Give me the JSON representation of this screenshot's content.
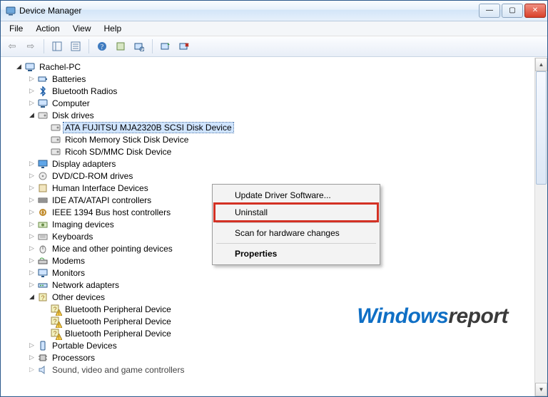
{
  "window": {
    "title": "Device Manager"
  },
  "menubar": [
    "File",
    "Action",
    "View",
    "Help"
  ],
  "toolbar_icons": [
    "nav-back-icon",
    "nav-forward-icon",
    "sep",
    "show-tree-icon",
    "properties-icon",
    "sep",
    "help-icon",
    "action-icon",
    "scan-icon",
    "sep",
    "update-drv-icon",
    "uninstall-drv-icon"
  ],
  "tree": {
    "root": {
      "label": "Rachel-PC",
      "expanded": true,
      "icon": "computer-icon",
      "children": [
        {
          "label": "Batteries",
          "icon": "battery-icon",
          "expanded": false,
          "has_children": true
        },
        {
          "label": "Bluetooth Radios",
          "icon": "bluetooth-icon",
          "expanded": false,
          "has_children": true
        },
        {
          "label": "Computer",
          "icon": "computer-icon",
          "expanded": false,
          "has_children": true
        },
        {
          "label": "Disk drives",
          "icon": "disk-icon",
          "expanded": true,
          "has_children": true,
          "children": [
            {
              "label": "ATA FUJITSU MJA2320B SCSI Disk Device",
              "icon": "disk-icon",
              "selected": true
            },
            {
              "label": "Ricoh Memory Stick Disk Device",
              "icon": "disk-icon"
            },
            {
              "label": "Ricoh SD/MMC Disk Device",
              "icon": "disk-icon"
            }
          ]
        },
        {
          "label": "Display adapters",
          "icon": "display-icon",
          "expanded": false,
          "has_children": true
        },
        {
          "label": "DVD/CD-ROM drives",
          "icon": "optical-icon",
          "expanded": false,
          "has_children": true
        },
        {
          "label": "Human Interface Devices",
          "icon": "hid-icon",
          "expanded": false,
          "has_children": true
        },
        {
          "label": "IDE ATA/ATAPI controllers",
          "icon": "ide-icon",
          "expanded": false,
          "has_children": true
        },
        {
          "label": "IEEE 1394 Bus host controllers",
          "icon": "firewire-icon",
          "expanded": false,
          "has_children": true
        },
        {
          "label": "Imaging devices",
          "icon": "imaging-icon",
          "expanded": false,
          "has_children": true
        },
        {
          "label": "Keyboards",
          "icon": "keyboard-icon",
          "expanded": false,
          "has_children": true
        },
        {
          "label": "Mice and other pointing devices",
          "icon": "mouse-icon",
          "expanded": false,
          "has_children": true
        },
        {
          "label": "Modems",
          "icon": "modem-icon",
          "expanded": false,
          "has_children": true
        },
        {
          "label": "Monitors",
          "icon": "monitor-icon",
          "expanded": false,
          "has_children": true
        },
        {
          "label": "Network adapters",
          "icon": "network-icon",
          "expanded": false,
          "has_children": true
        },
        {
          "label": "Other devices",
          "icon": "other-icon",
          "expanded": true,
          "has_children": true,
          "children": [
            {
              "label": "Bluetooth Peripheral Device",
              "icon": "unknown-device-icon",
              "warning": true
            },
            {
              "label": "Bluetooth Peripheral Device",
              "icon": "unknown-device-icon",
              "warning": true
            },
            {
              "label": "Bluetooth Peripheral Device",
              "icon": "unknown-device-icon",
              "warning": true
            }
          ]
        },
        {
          "label": "Portable Devices",
          "icon": "portable-icon",
          "expanded": false,
          "has_children": true
        },
        {
          "label": "Processors",
          "icon": "cpu-icon",
          "expanded": false,
          "has_children": true
        },
        {
          "label": "Sound, video and game controllers",
          "icon": "sound-icon",
          "expanded": false,
          "has_children": true,
          "cutoff": true
        }
      ]
    }
  },
  "context_menu": {
    "items": [
      {
        "label": "Update Driver Software...",
        "key": "update-driver"
      },
      {
        "label": "Uninstall",
        "key": "uninstall",
        "highlight": true
      },
      {
        "sep": true
      },
      {
        "label": "Scan for hardware changes",
        "key": "scan-hardware"
      },
      {
        "sep": true
      },
      {
        "label": "Properties",
        "key": "properties",
        "bold": true
      }
    ]
  },
  "watermark": {
    "blue": "Windows",
    "dark": "report"
  }
}
